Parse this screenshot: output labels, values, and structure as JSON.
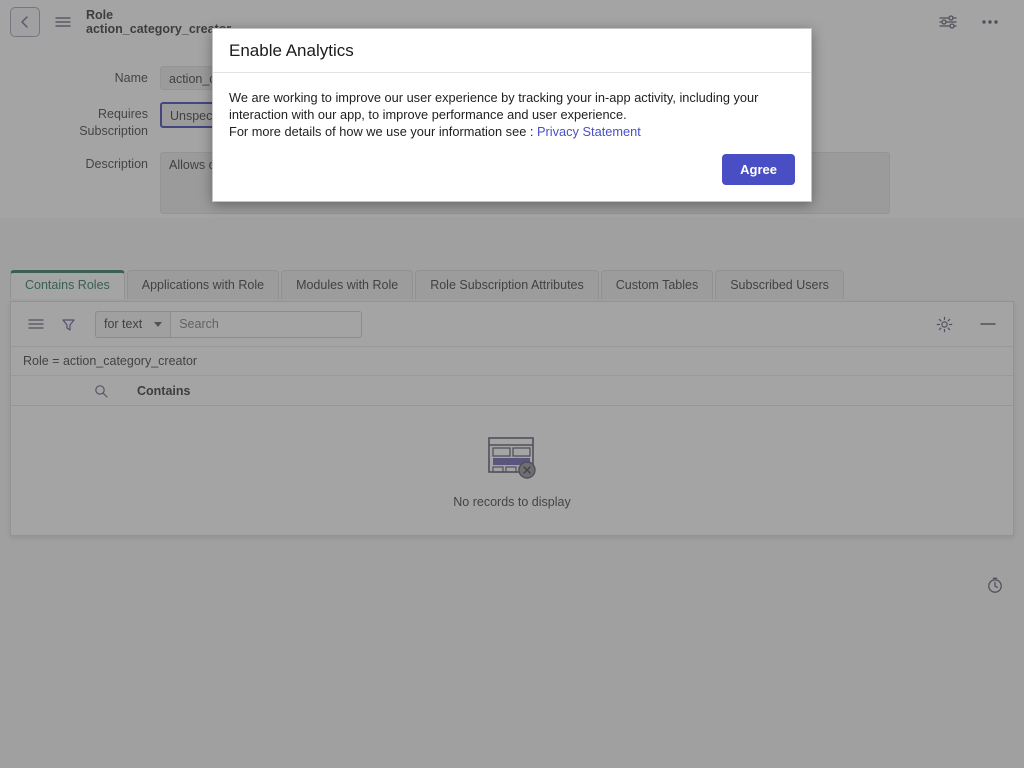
{
  "header": {
    "back_icon": "chevron-left-icon",
    "menu_icon": "hamburger-menu-icon",
    "kind": "Role",
    "record_name": "action_category_creator",
    "settings_icon": "sliders-icon",
    "overflow_icon": "more-options-icon"
  },
  "form": {
    "fields": [
      {
        "label": "Name",
        "value": "action_category_creator"
      },
      {
        "label": "Requires Subscription",
        "value": "Unspecified"
      },
      {
        "label": "Description",
        "value": "Allows creation of action categories"
      }
    ]
  },
  "tabs": [
    {
      "label": "Contains Roles",
      "active": true
    },
    {
      "label": "Applications with Role",
      "active": false
    },
    {
      "label": "Modules with Role",
      "active": false
    },
    {
      "label": "Role Subscription Attributes",
      "active": false
    },
    {
      "label": "Custom Tables",
      "active": false
    },
    {
      "label": "Subscribed Users",
      "active": false
    }
  ],
  "grid": {
    "toolbar": {
      "list_icon": "list-view-icon",
      "filter_icon": "funnel-filter-icon",
      "search_scope": "for text",
      "search_placeholder": "Search",
      "search_value": "",
      "gear_icon": "gear-icon",
      "minimize_icon": "minimize-icon"
    },
    "filter_text": "Role = action_category_creator",
    "column_search_icon": "search-icon",
    "columns": [
      "Contains"
    ],
    "empty_icon": "no-records-table-icon",
    "empty_text": "No records to display",
    "rows": []
  },
  "footer": {
    "clock_icon": "clock-icon"
  },
  "modal": {
    "title": "Enable Analytics",
    "paragraph_1": "We are working to improve our user experience by tracking your in-app activity, including your interaction with our app, to improve performance and user experience.",
    "paragraph_2_prefix": "For more details of how we use your information see : ",
    "privacy_link": "Privacy Statement",
    "agree_label": "Agree"
  },
  "colors": {
    "accent_green": "#12694a",
    "accent_blue": "#4a4ec4",
    "focus_blue": "#2b2fa8",
    "link_blue": "#4a4fc4"
  }
}
